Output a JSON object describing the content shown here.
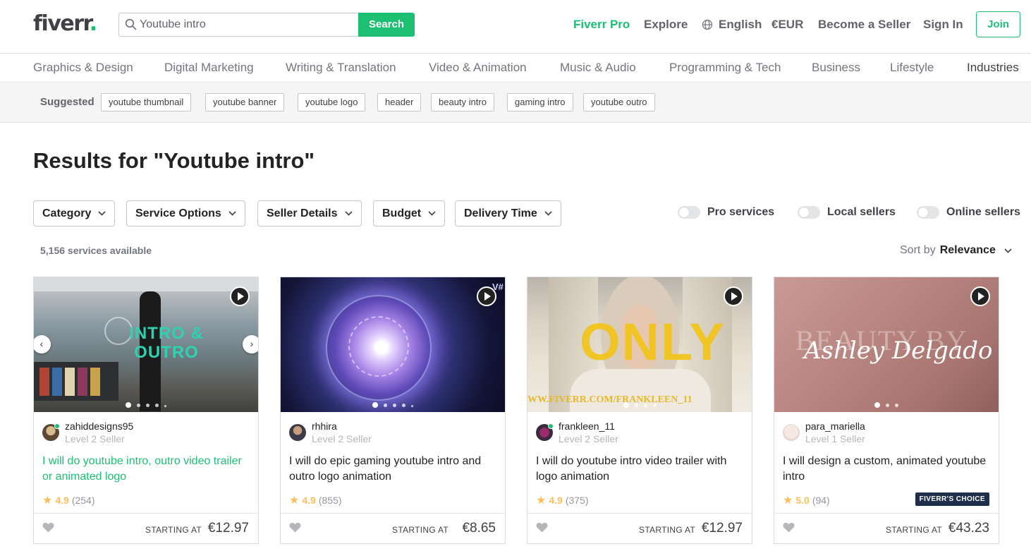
{
  "header": {
    "logo_text": "fiverr",
    "logo_dot": ".",
    "search_value": "Youtube intro",
    "search_button": "Search",
    "nav": {
      "pro": "Fiverr Pro",
      "explore": "Explore",
      "language": "English",
      "currency": "€EUR",
      "become_seller": "Become a Seller",
      "sign_in": "Sign In",
      "join": "Join"
    }
  },
  "categories": [
    "Graphics & Design",
    "Digital Marketing",
    "Writing & Translation",
    "Video & Animation",
    "Music & Audio",
    "Programming & Tech",
    "Business",
    "Lifestyle",
    "Industries"
  ],
  "suggested": {
    "label": "Suggested",
    "tags": [
      "youtube thumbnail",
      "youtube banner",
      "youtube logo",
      "header",
      "beauty intro",
      "gaming intro",
      "youtube outro"
    ]
  },
  "results_title": "Results for \"Youtube intro\"",
  "filters": [
    "Category",
    "Service Options",
    "Seller Details",
    "Budget",
    "Delivery Time"
  ],
  "toggles": [
    "Pro services",
    "Local sellers",
    "Online sellers"
  ],
  "services_count": "5,156 services available",
  "sort": {
    "label": "Sort by",
    "value": "Relevance"
  },
  "gigs": [
    {
      "thumb_text": "INTRO &\nOUTRO",
      "seller": "zahiddesigns95",
      "level": "Level 2 Seller",
      "title": "I will do youtube intro, outro video trailer or animated logo",
      "rating": "4.9",
      "reviews": "(254)",
      "starting_at": "STARTING AT",
      "price": "€12.97"
    },
    {
      "thumb_text": "V#",
      "seller": "rhhira",
      "level": "Level 2 Seller",
      "title": "I will do epic gaming youtube intro and outro logo animation",
      "rating": "4.9",
      "reviews": "(855)",
      "starting_at": "STARTING AT",
      "price": "€8.65"
    },
    {
      "thumb_text": "ONLY",
      "thumb_subtext": "WW.FIVERR.COM/FRANKLEEN_11",
      "seller": "frankleen_11",
      "level": "Level 2 Seller",
      "title": "I will do youtube intro video trailer with logo animation",
      "rating": "4.9",
      "reviews": "(375)",
      "starting_at": "STARTING AT",
      "price": "€12.97"
    },
    {
      "thumb_text": "BEAUTY BY",
      "thumb_script": "Ashley Delgado",
      "seller": "para_mariella",
      "level": "Level 1 Seller",
      "title": "I will design a custom, animated youtube intro",
      "rating": "5.0",
      "reviews": "(94)",
      "badge": "FIVERR'S CHOICE",
      "starting_at": "STARTING AT",
      "price": "€43.23"
    }
  ],
  "colors": {
    "brand_green": "#1dbf73",
    "text_dark": "#222325",
    "star": "#ffbe5b",
    "badge_bg": "#1f2e4b"
  }
}
